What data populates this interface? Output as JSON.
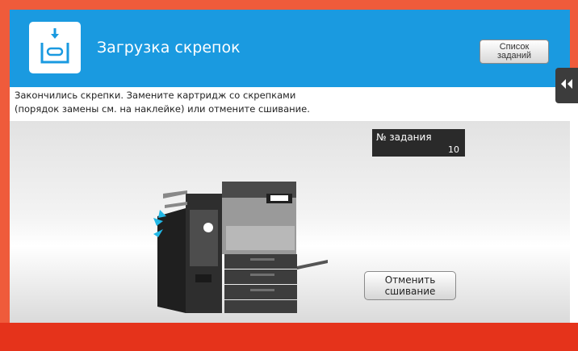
{
  "header": {
    "title": "Загрузка скрепок",
    "icon": "staple-load-icon",
    "job_list_label": "Список заданий",
    "collapse_icon": "double-chevron-left-icon"
  },
  "message": {
    "line1": "Закончились скрепки. Замените картридж со скрепками",
    "line2": "(порядок замены см. на наклейке) или отмените сшивание."
  },
  "job": {
    "label": "№ задания",
    "number": "10"
  },
  "cancel_button_label": "Отменить сшивание",
  "colors": {
    "frame": "#ef5b3b",
    "header": "#1a9ae0",
    "bottom_bar": "#e5331b"
  }
}
